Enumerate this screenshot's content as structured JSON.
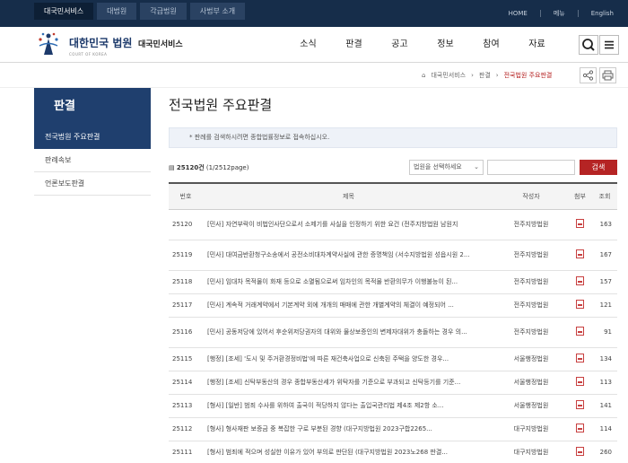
{
  "topbar": {
    "tabs": [
      {
        "label": "대국민서비스",
        "active": true
      },
      {
        "label": "대법원",
        "active": false
      },
      {
        "label": "각급법원",
        "active": false
      },
      {
        "label": "사법부 소개",
        "active": false
      }
    ],
    "util": [
      "HOME",
      "메뉴",
      "English"
    ]
  },
  "header": {
    "logo_name": "대한민국 법원",
    "logo_service": "대국민서비스",
    "logo_eng": "COURT OF KOREA",
    "gnb": [
      "소식",
      "판결",
      "공고",
      "정보",
      "참여",
      "자료"
    ]
  },
  "breadcrumb": {
    "items": [
      "대국민서비스",
      "판결",
      "전국법원 주요판결"
    ]
  },
  "sidebar": {
    "title": "판결",
    "items": [
      "전국법원 주요판결",
      "판례속보",
      "언론보도판결"
    ]
  },
  "main": {
    "title": "전국법원 주요판결",
    "notice": "* 판례를 검색하시려면 종합법률정보로 접속하십시오.",
    "count_total": "25120건",
    "count_page": "(1/2512page)",
    "select_placeholder": "법원을 선택하세요",
    "search_placeholder": "",
    "search_button": "검색",
    "columns": [
      "번호",
      "제목",
      "작성자",
      "첨부",
      "조회"
    ],
    "rows": [
      {
        "no": "25120",
        "title": "[민사] 자연부락이 비법인사단으로서 소제기를 사실을 인정하기 위한 요건 (전주지방법원 남원지",
        "court": "전주지방법원",
        "views": "163",
        "tall": true
      },
      {
        "no": "25119",
        "title": "[민사] 대여금반환청구소송에서 공전소비대차계약사실에 관한 증명책임 (서수지방법원 성읍시원 2...",
        "court": "전주지방법원",
        "views": "167",
        "tall": true
      },
      {
        "no": "25118",
        "title": "[민사] 임대차 목적물이 화재 등으로 소멸됨으로써 임차인의 목적물 반환의무가 이행불능이 된...",
        "court": "전주지방법원",
        "views": "157",
        "tall": false
      },
      {
        "no": "25117",
        "title": "[민사] 계속적 거래계약에서 기본계약 외에 개개의 매매에 관한 개별계약의 체결이 예정되어 ...",
        "court": "전주지방법원",
        "views": "121",
        "tall": false
      },
      {
        "no": "25116",
        "title": "[민사] 공동저당에 있어서 후순위저당권자의 대위와 물상보증인의 변제자대위가 충돌하는 경우 의...",
        "court": "전주지방법원",
        "views": "91",
        "tall": true
      },
      {
        "no": "25115",
        "title": "[행정] [조세] '도시 및 주거환경정비법'에 따른 재건축사업으로 신축된 주택을 양도한 경우...",
        "court": "서울행정법원",
        "views": "134",
        "tall": false
      },
      {
        "no": "25114",
        "title": "[행정] [조세] 신탁부동산의 경우 종합부동산세가 위탁자를 기준으로 부과되고 신탁등기를 기준...",
        "court": "서울행정법원",
        "views": "113",
        "tall": false
      },
      {
        "no": "25113",
        "title": "[형사] [일반] 범죄 수사를 위하여 출국이 적당하지 않다는 출입국관리법 제4조 제2항 소...",
        "court": "서울행정법원",
        "views": "141",
        "tall": false
      },
      {
        "no": "25112",
        "title": "[형사] 형사재판 보증금 중 복잡한 구로 부분된 경향 (대구지방법원 2023구합2265...",
        "court": "대구지방법원",
        "views": "114",
        "tall": false
      },
      {
        "no": "25111",
        "title": "[형사] 범죄에 적으며 성실한 이유가 있어 부의로 판단된 (대구지방법원 2023노268 판결...",
        "court": "대구지방법원",
        "views": "260",
        "tall": false
      }
    ]
  }
}
